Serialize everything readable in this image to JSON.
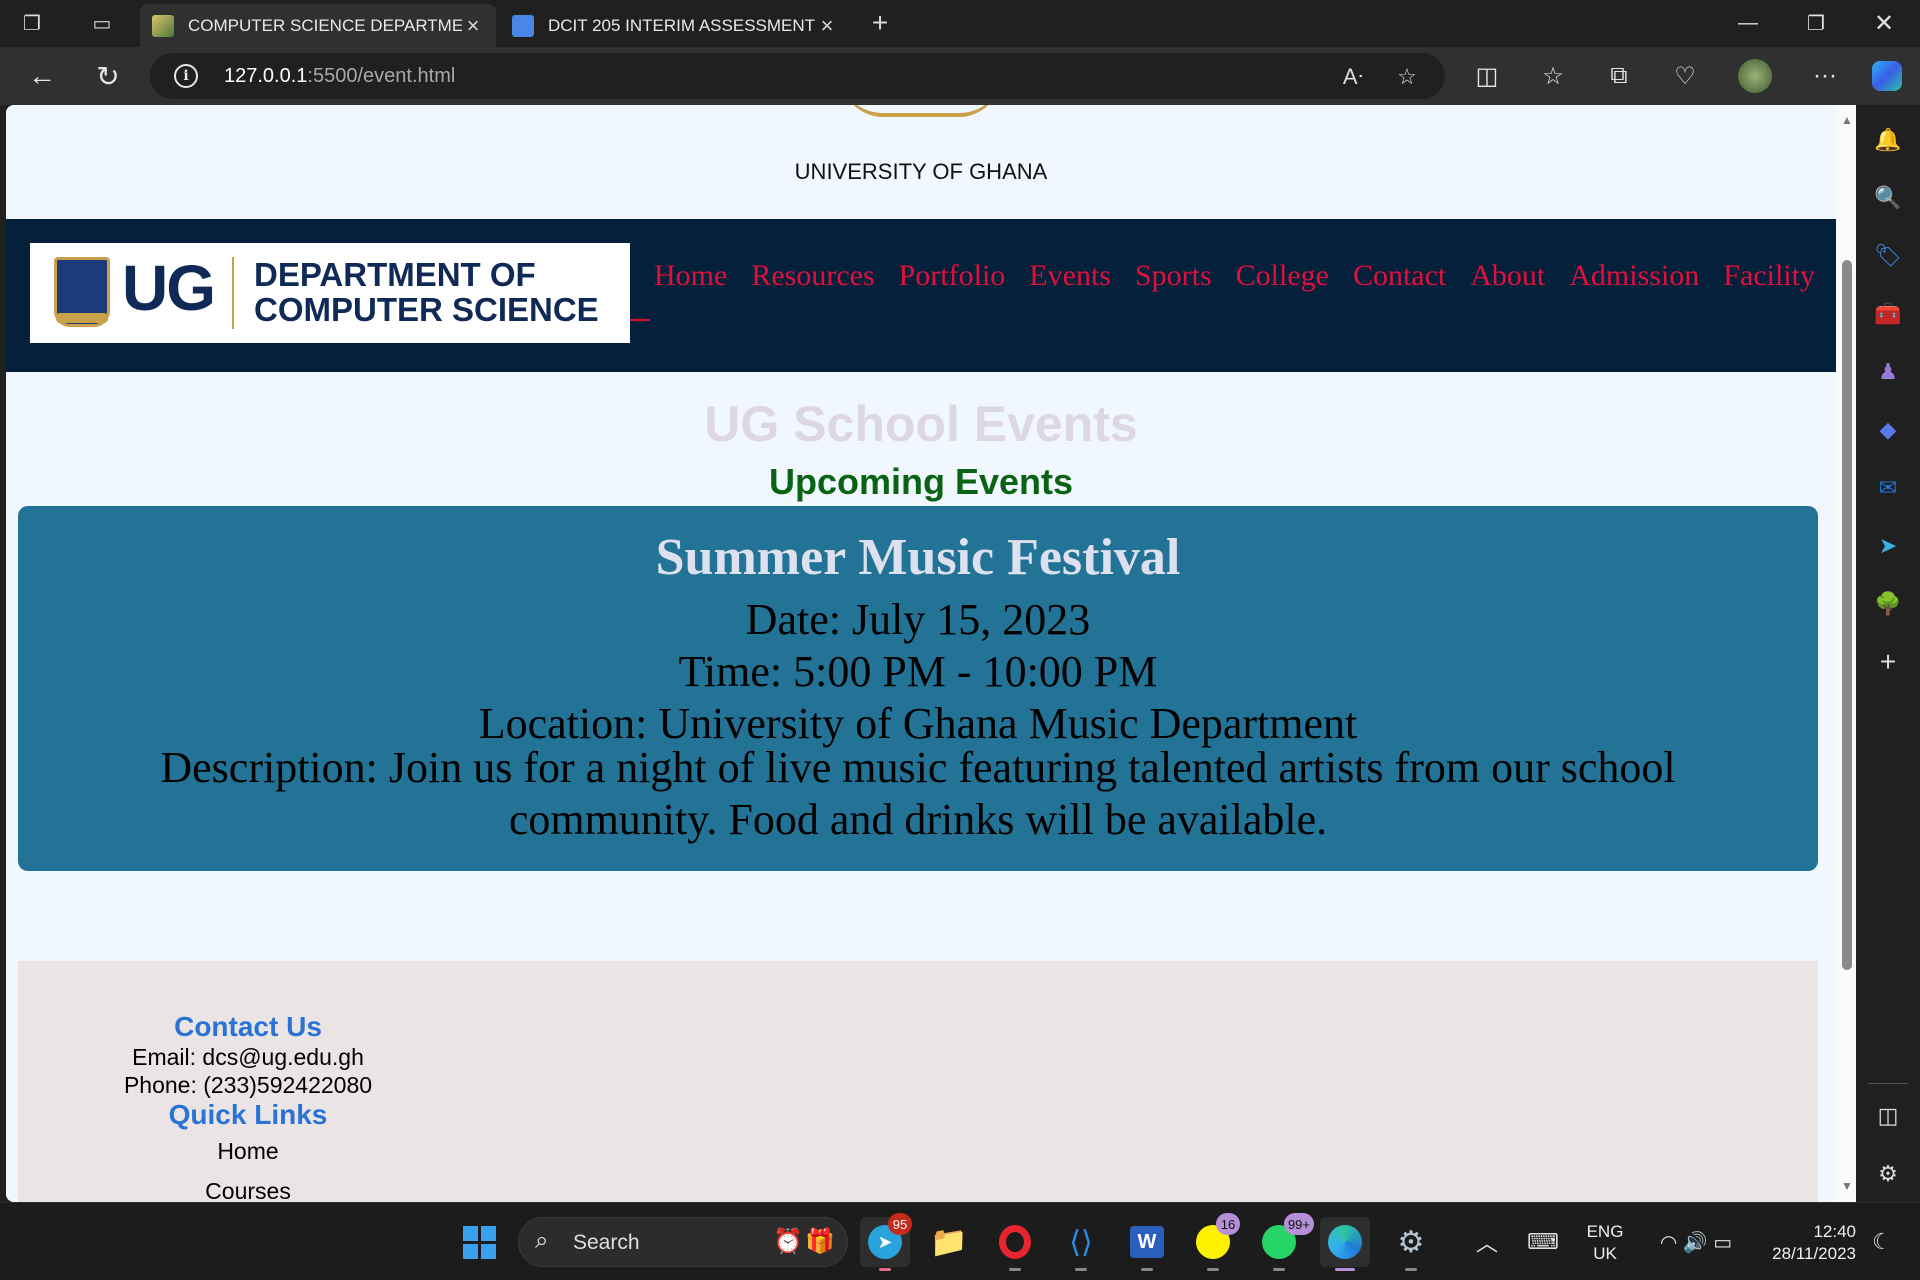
{
  "tabs": [
    {
      "title": "COMPUTER SCIENCE DEPARTMENT",
      "active": true
    },
    {
      "title": "DCIT 205 INTERIM ASSESSMENT",
      "active": false
    }
  ],
  "address": {
    "host": "127.0.0.1",
    "rest": ":5500/event.html"
  },
  "page": {
    "university": "UNIVERSITY OF GHANA",
    "brand": {
      "ug": "UG",
      "dept_line1": "DEPARTMENT OF",
      "dept_line2": "COMPUTER SCIENCE"
    },
    "nav": [
      "Home",
      "Resources",
      "Portfolio",
      "Events",
      "Sports",
      "College",
      "Contact",
      "About",
      "Admission",
      "Facility"
    ],
    "heading": "UG School Events",
    "subheading": "Upcoming Events",
    "event": {
      "name": "Summer Music Festival",
      "date": "Date: July 15, 2023",
      "time": "Time: 5:00 PM - 10:00 PM",
      "location": "Location: University of Ghana Music Department",
      "description": "Description: Join us for a night of live music featuring talented artists from our school community. Food and drinks will be available."
    },
    "footer": {
      "contact_heading": "Contact Us",
      "email": "Email: dcs@ug.edu.gh",
      "phone": "Phone: (233)592422080",
      "links_heading": "Quick Links",
      "links": [
        "Home",
        "Courses"
      ]
    }
  },
  "taskbar": {
    "search_label": "Search",
    "badges": {
      "telegram": "95",
      "snapchat": "16",
      "whatsapp": "99+"
    },
    "lang_line1": "ENG",
    "lang_line2": "UK",
    "time": "12:40",
    "date": "28/11/2023"
  },
  "colors": {
    "nav_bg": "#04203a",
    "nav_link": "#e0103c",
    "event_card": "#237396",
    "upcoming": "#0a6312",
    "footer_heading": "#2a73d6"
  }
}
